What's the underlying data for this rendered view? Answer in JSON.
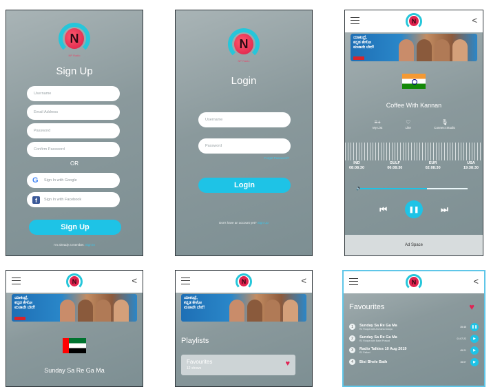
{
  "signup": {
    "logo_tag": "NP Radio",
    "title": "Sign Up",
    "username_placeholder": "Username",
    "email_placeholder": "Email Address",
    "password_placeholder": "Password",
    "confirm_placeholder": "Confirm Password",
    "or_text": "OR",
    "google_label": "Sign In with Google",
    "facebook_label": "Sign In with Facebook",
    "submit_label": "Sign Up",
    "already_member": "I'm already a member.",
    "signin_link": "Sign In"
  },
  "login": {
    "logo_tag": "NP Radio",
    "title": "Login",
    "username_placeholder": "Username",
    "password_placeholder": "Password",
    "forgot_link": "Forgot Password?",
    "submit_label": "Login",
    "no_account": "Don't have an account yet?",
    "signup_link": "Sign Up"
  },
  "player": {
    "logo_tag": "NP Radio",
    "banner_text": "ಯಾಕಂದ್ರೆ,\nಕನ್ನಡ ಕೇಳೋ\nಮಜಾನೇ ಬೇರೆ!",
    "show_title": "Coffee With Kannan",
    "actions": [
      {
        "icon": "playlist-add-icon",
        "glyph": "≡+",
        "label": "My List"
      },
      {
        "icon": "heart-outline-icon",
        "glyph": "♡",
        "label": "Like"
      },
      {
        "icon": "microphone-icon",
        "glyph": "🎙",
        "label": "Connect Studio"
      }
    ],
    "zones": [
      {
        "code": "IND",
        "time": "08:08:30"
      },
      {
        "code": "GULF",
        "time": "06:08:30"
      },
      {
        "code": "EUR",
        "time": "02:08:30"
      },
      {
        "code": "USA",
        "time": "19:38:30"
      }
    ],
    "volume_level": 0.62,
    "prev_glyph": "⏮",
    "pause_glyph": "❚❚",
    "next_glyph": "⏭",
    "ad_label": "Ad Space"
  },
  "player2": {
    "banner_text": "ಯಾಕಂದ್ರೆ,\nಕನ್ನಡ ಕೇಳೋ\nಮಜಾನೇ ಬೇರೆ!",
    "show_title": "Sunday Sa Re Ga Ma"
  },
  "playlists": {
    "banner_text": "ಯಾಕಂದ್ರೆ,\nಕನ್ನಡ ಕೇಳೋ\nಮಜಾನೇ ಬೇರೆ!",
    "title": "Playlists",
    "card_title": "Favourites",
    "card_sub": "12 shows"
  },
  "favourites": {
    "title": "Favourites",
    "items": [
      {
        "num": "1",
        "name": "Sunday Sa Re Ga Ma",
        "sub": "RJ Roopa with Archana Udupa",
        "dur": "35:45",
        "state": "❚❚"
      },
      {
        "num": "2",
        "name": "Sunday Sa Re Ga Ma",
        "sub": "RJ Roopa with Badri Prasad",
        "dur": "01:07:22",
        "state": "▶"
      },
      {
        "num": "3",
        "name": "Radio Talkies 10 Aug 2019",
        "sub": "RJ Pallavi",
        "dur": "45:21",
        "state": "▶"
      },
      {
        "num": "4",
        "name": "Bisi Bhele Bath",
        "sub": "",
        "dur": "15:07",
        "state": "▶"
      }
    ]
  },
  "colors": {
    "accent": "#1ec3e6",
    "heart": "#e02454",
    "brand": "#e0214d"
  }
}
